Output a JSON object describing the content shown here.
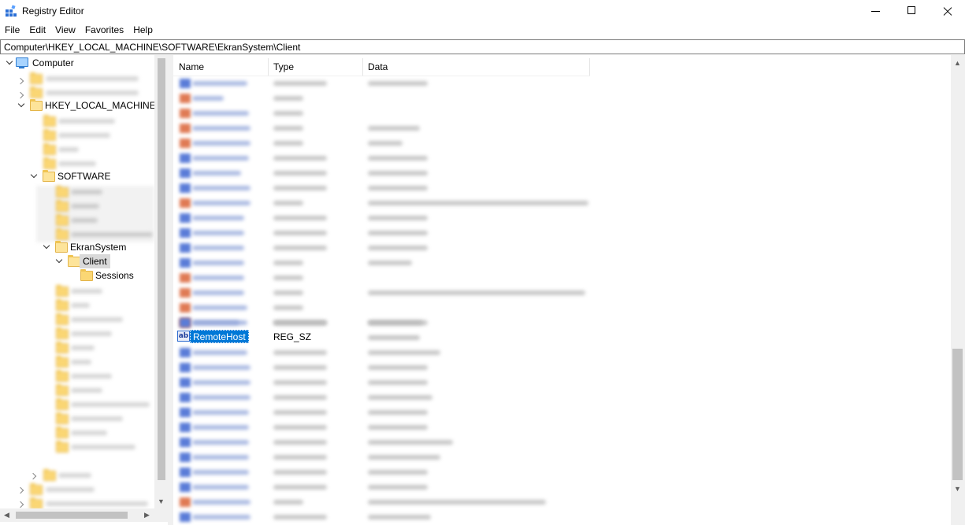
{
  "window": {
    "title": "Registry Editor"
  },
  "menu": [
    "File",
    "Edit",
    "View",
    "Favorites",
    "Help"
  ],
  "address": "Computer\\HKEY_LOCAL_MACHINE\\SOFTWARE\\EkranSystem\\Client",
  "tree": {
    "root": "Computer",
    "hive": "HKEY_LOCAL_MACHINE",
    "software": "SOFTWARE",
    "ekran": "EkranSystem",
    "client": "Client",
    "sessions": "Sessions"
  },
  "columns": {
    "name": "Name",
    "type": "Type",
    "data": "Data"
  },
  "selected_value": {
    "name": "RemoteHost",
    "type": "REG_SZ",
    "icon": "string-value-icon"
  },
  "colors": {
    "selection": "#0078d7",
    "folder": "#fbd774",
    "dword_icon": "#5a7cd8",
    "string_icon": "#e07a54"
  }
}
